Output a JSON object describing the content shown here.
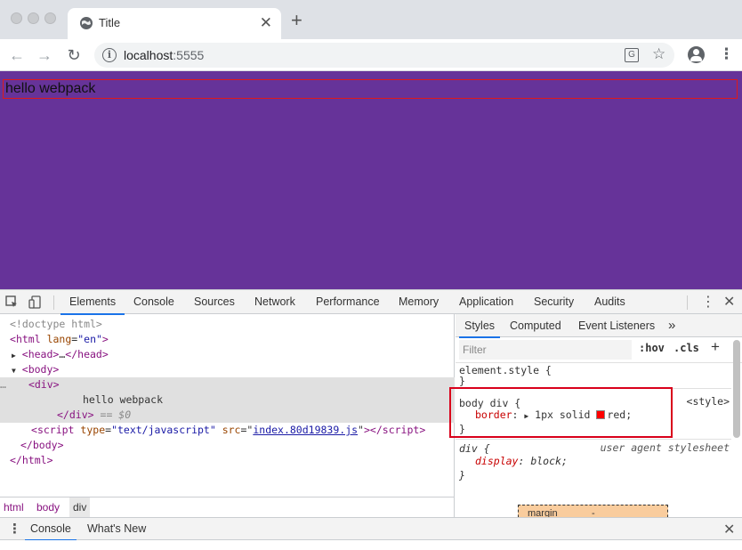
{
  "browser": {
    "tab_title": "Title",
    "tab_close": "✕",
    "new_tab": "+",
    "url_host": "localhost",
    "url_port": ":5555",
    "back": "←",
    "forward": "→",
    "reload": "↻",
    "star": "☆",
    "translate": "G",
    "menu": "⋮"
  },
  "page": {
    "text": "hello webpack",
    "background": "#663399",
    "border_color": "#e01919"
  },
  "devtools": {
    "tabs": [
      "Elements",
      "Console",
      "Sources",
      "Network",
      "Performance",
      "Memory",
      "Application",
      "Security",
      "Audits"
    ],
    "active_tab": "Elements",
    "menu": "⋮",
    "close": "✕",
    "dom": {
      "doctype": "<!doctype html>",
      "html_open_tag": "html",
      "html_lang_attr": "lang",
      "html_lang_val": "\"en\"",
      "head_collapsed": "…",
      "head_tag": "head",
      "body_tag": "body",
      "div_tag": "div",
      "div_text": "hello webpack",
      "eq_dollar": "== $0",
      "script_tag": "script",
      "script_type_attr": "type",
      "script_type_val": "\"text/javascript\"",
      "script_src_attr": "src",
      "script_src_val": "index.80d19839.js",
      "ellipsis": "…"
    },
    "breadcrumbs": [
      "html",
      "body",
      "div"
    ],
    "styles": {
      "tabs": [
        "Styles",
        "Computed",
        "Event Listeners",
        "»"
      ],
      "filter_placeholder": "Filter",
      "hov": ":hov",
      "cls": ".cls",
      "add": "+",
      "element_style_selector": "element.style {",
      "close_brace": "}",
      "rule1_selector": "body div {",
      "rule1_source": "<style>",
      "rule1_prop": "border",
      "rule1_value_pre": "1px solid ",
      "rule1_value_post": "red;",
      "rule1_swatch_color": "#ff0000",
      "rule2_selector": "div {",
      "rule2_source": "user agent stylesheet",
      "rule2_prop": "display",
      "rule2_value": "block;",
      "boxmodel_label": "margin",
      "boxmodel_value": "-"
    },
    "drawer": {
      "tabs": [
        "Console",
        "What's New"
      ],
      "active_tab": "Console",
      "close": "✕"
    }
  }
}
